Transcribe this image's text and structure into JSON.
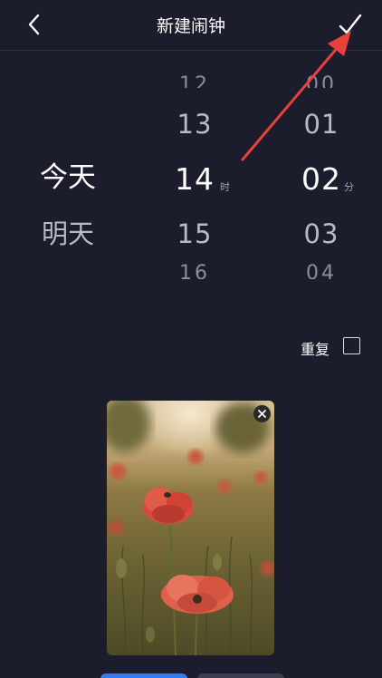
{
  "header": {
    "title": "新建闹钟",
    "back_icon": "chevron-left-icon",
    "confirm_icon": "checkmark-icon"
  },
  "picker": {
    "days": {
      "selected": "今天",
      "next": "明天"
    },
    "hours": {
      "faint_prev": "12",
      "prev": "13",
      "selected": "14",
      "next": "15",
      "faint_next": "16",
      "unit": "时"
    },
    "minutes": {
      "faint_prev": "00",
      "prev": "01",
      "selected": "02",
      "next": "03",
      "faint_next": "04",
      "unit": "分"
    }
  },
  "repeat": {
    "label": "重复",
    "checked": false
  },
  "photo": {
    "close_icon": "close-icon",
    "description_icon": "photo-image"
  },
  "colors": {
    "background": "#1b1d2d",
    "annotation_arrow": "#e8403a",
    "primary_button": "#2f7df6"
  }
}
